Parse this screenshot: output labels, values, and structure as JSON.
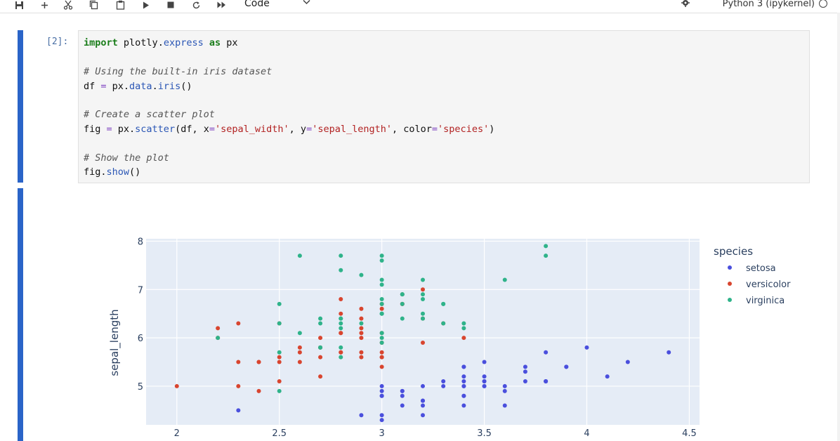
{
  "toolbar": {
    "icons": [
      "save-icon",
      "add-cell-icon",
      "cut-icon",
      "copy-icon",
      "paste-icon",
      "run-icon",
      "stop-icon",
      "restart-icon",
      "fast-forward-icon"
    ],
    "cell_type": "Code",
    "kernel": "Python 3 (ipykernel)"
  },
  "cell": {
    "prompt": "[2]:",
    "code": {
      "l1": {
        "kw1": "import",
        "mod": " plotly",
        "dot": ".",
        "attr": "express",
        "sp": " ",
        "kw2": "as",
        "alias": " px"
      },
      "l2": "# Using the built-in iris dataset",
      "l3": {
        "a": "df ",
        "eq": "=",
        "b": " px.",
        "c": "data",
        "d": ".",
        "e": "iris",
        "f": "()"
      },
      "l4": "# Create a scatter plot",
      "l5": {
        "a": "fig ",
        "eq": "=",
        "b": " px.",
        "c": "scatter",
        "d": "(df, x",
        "e": "=",
        "f": "'sepal_width'",
        "g": ", y",
        "h": "=",
        "i": "'sepal_length'",
        "j": ", color",
        "k": "=",
        "l": "'species'",
        "m": ")"
      },
      "l6": "# Show the plot",
      "l7": {
        "a": "fig.",
        "b": "show",
        "c": "()"
      }
    }
  },
  "chart_data": {
    "type": "scatter",
    "xlabel": "",
    "ylabel": "sepal_length",
    "xlim": [
      1.85,
      4.55
    ],
    "ylim": [
      4.2,
      8.05
    ],
    "x_ticks": [
      "2",
      "2.5",
      "3",
      "3.5",
      "4",
      "4.5"
    ],
    "y_ticks": [
      "5",
      "6",
      "7",
      "8"
    ],
    "grid": true,
    "legend_title": "species",
    "legend_position": "right",
    "series": [
      {
        "name": "setosa",
        "color": "#4a4fdd",
        "points": [
          [
            3.5,
            5.1
          ],
          [
            3.0,
            4.9
          ],
          [
            3.2,
            4.7
          ],
          [
            3.1,
            4.6
          ],
          [
            3.6,
            5.0
          ],
          [
            3.9,
            5.4
          ],
          [
            3.4,
            4.6
          ],
          [
            3.4,
            5.0
          ],
          [
            2.9,
            4.4
          ],
          [
            3.1,
            4.9
          ],
          [
            3.7,
            5.4
          ],
          [
            3.4,
            4.8
          ],
          [
            3.0,
            4.8
          ],
          [
            3.0,
            4.3
          ],
          [
            4.0,
            5.8
          ],
          [
            4.4,
            5.7
          ],
          [
            3.9,
            5.4
          ],
          [
            3.5,
            5.1
          ],
          [
            3.8,
            5.7
          ],
          [
            3.8,
            5.1
          ],
          [
            3.4,
            5.4
          ],
          [
            3.7,
            5.1
          ],
          [
            3.6,
            4.6
          ],
          [
            3.3,
            5.1
          ],
          [
            3.4,
            4.8
          ],
          [
            3.0,
            5.0
          ],
          [
            3.4,
            5.0
          ],
          [
            3.5,
            5.2
          ],
          [
            3.4,
            5.2
          ],
          [
            3.2,
            4.7
          ],
          [
            3.1,
            4.8
          ],
          [
            3.4,
            5.4
          ],
          [
            4.1,
            5.2
          ],
          [
            4.2,
            5.5
          ],
          [
            3.1,
            4.9
          ],
          [
            3.2,
            5.0
          ],
          [
            3.5,
            5.5
          ],
          [
            3.6,
            4.9
          ],
          [
            3.0,
            4.4
          ],
          [
            3.4,
            5.1
          ],
          [
            3.5,
            5.0
          ],
          [
            2.3,
            4.5
          ],
          [
            3.2,
            4.4
          ],
          [
            3.5,
            5.0
          ],
          [
            3.8,
            5.1
          ],
          [
            3.0,
            4.8
          ],
          [
            3.8,
            5.1
          ],
          [
            3.2,
            4.6
          ],
          [
            3.7,
            5.3
          ],
          [
            3.3,
            5.0
          ]
        ]
      },
      {
        "name": "versicolor",
        "color": "#d8452f",
        "points": [
          [
            3.2,
            7.0
          ],
          [
            3.2,
            6.4
          ],
          [
            3.1,
            6.9
          ],
          [
            2.3,
            5.5
          ],
          [
            2.8,
            6.5
          ],
          [
            2.8,
            5.7
          ],
          [
            3.3,
            6.3
          ],
          [
            2.4,
            4.9
          ],
          [
            2.9,
            6.6
          ],
          [
            2.7,
            5.2
          ],
          [
            2.0,
            5.0
          ],
          [
            3.0,
            5.9
          ],
          [
            2.2,
            6.0
          ],
          [
            2.9,
            6.1
          ],
          [
            2.9,
            5.6
          ],
          [
            3.1,
            6.7
          ],
          [
            3.0,
            5.6
          ],
          [
            2.7,
            5.8
          ],
          [
            2.2,
            6.2
          ],
          [
            2.5,
            5.6
          ],
          [
            3.2,
            5.9
          ],
          [
            2.8,
            6.1
          ],
          [
            2.5,
            6.3
          ],
          [
            2.8,
            6.1
          ],
          [
            2.9,
            6.4
          ],
          [
            3.0,
            6.6
          ],
          [
            2.8,
            6.8
          ],
          [
            3.0,
            6.7
          ],
          [
            2.9,
            6.0
          ],
          [
            2.6,
            5.7
          ],
          [
            2.4,
            5.5
          ],
          [
            2.4,
            5.5
          ],
          [
            2.7,
            5.8
          ],
          [
            2.7,
            6.0
          ],
          [
            3.0,
            5.4
          ],
          [
            3.4,
            6.0
          ],
          [
            3.1,
            6.7
          ],
          [
            2.3,
            6.3
          ],
          [
            3.0,
            5.6
          ],
          [
            2.5,
            5.5
          ],
          [
            2.6,
            5.5
          ],
          [
            3.0,
            6.1
          ],
          [
            2.6,
            5.8
          ],
          [
            2.3,
            5.0
          ],
          [
            2.7,
            5.6
          ],
          [
            3.0,
            5.7
          ],
          [
            2.9,
            5.7
          ],
          [
            2.9,
            6.2
          ],
          [
            2.5,
            5.1
          ],
          [
            2.8,
            5.7
          ]
        ]
      },
      {
        "name": "virginica",
        "color": "#2fb38a",
        "points": [
          [
            3.3,
            6.3
          ],
          [
            2.7,
            5.8
          ],
          [
            3.0,
            7.1
          ],
          [
            2.9,
            6.3
          ],
          [
            3.0,
            6.5
          ],
          [
            3.0,
            7.6
          ],
          [
            2.5,
            4.9
          ],
          [
            2.9,
            7.3
          ],
          [
            2.5,
            6.7
          ],
          [
            3.6,
            7.2
          ],
          [
            3.2,
            6.5
          ],
          [
            2.7,
            6.4
          ],
          [
            3.0,
            6.8
          ],
          [
            2.5,
            5.7
          ],
          [
            2.8,
            5.8
          ],
          [
            3.2,
            6.4
          ],
          [
            3.0,
            6.5
          ],
          [
            3.8,
            7.7
          ],
          [
            2.6,
            7.7
          ],
          [
            2.2,
            6.0
          ],
          [
            3.2,
            6.9
          ],
          [
            2.8,
            5.6
          ],
          [
            2.8,
            7.7
          ],
          [
            2.7,
            6.3
          ],
          [
            3.3,
            6.7
          ],
          [
            3.2,
            7.2
          ],
          [
            2.8,
            6.2
          ],
          [
            3.0,
            6.1
          ],
          [
            2.8,
            6.4
          ],
          [
            3.0,
            7.2
          ],
          [
            2.8,
            7.4
          ],
          [
            3.8,
            7.9
          ],
          [
            2.8,
            6.4
          ],
          [
            2.8,
            6.3
          ],
          [
            2.6,
            6.1
          ],
          [
            3.0,
            7.7
          ],
          [
            3.4,
            6.3
          ],
          [
            3.1,
            6.4
          ],
          [
            3.0,
            6.0
          ],
          [
            3.1,
            6.9
          ],
          [
            3.1,
            6.7
          ],
          [
            3.1,
            6.9
          ],
          [
            2.7,
            5.8
          ],
          [
            3.2,
            6.8
          ],
          [
            3.3,
            6.7
          ],
          [
            3.0,
            6.7
          ],
          [
            2.5,
            6.3
          ],
          [
            3.0,
            6.5
          ],
          [
            3.4,
            6.2
          ],
          [
            3.0,
            5.9
          ]
        ]
      }
    ]
  }
}
